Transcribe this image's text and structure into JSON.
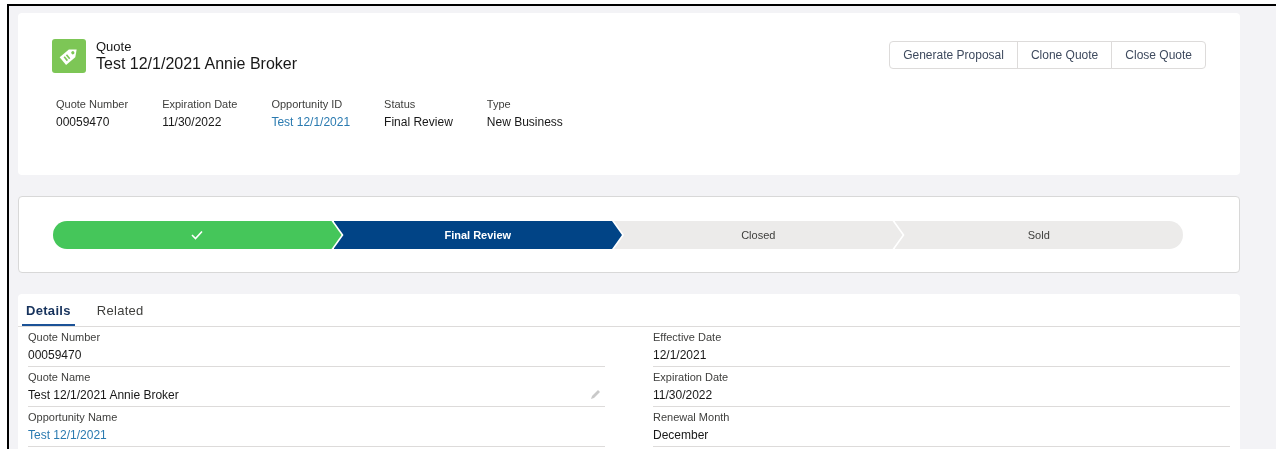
{
  "header": {
    "object_type": "Quote",
    "title": "Test 12/1/2021 Annie Broker",
    "actions": [
      "Generate Proposal",
      "Clone Quote",
      "Close Quote"
    ],
    "highlights": [
      {
        "label": "Quote Number",
        "value": "00059470",
        "link": false
      },
      {
        "label": "Expiration Date",
        "value": "11/30/2022",
        "link": false
      },
      {
        "label": "Opportunity ID",
        "value": "Test 12/1/2021",
        "link": true
      },
      {
        "label": "Status",
        "value": "Final Review",
        "link": false
      },
      {
        "label": "Type",
        "value": "New Business",
        "link": false
      }
    ]
  },
  "path": {
    "stages": [
      {
        "kind": "complete"
      },
      {
        "label": "Final Review",
        "kind": "current"
      },
      {
        "label": "Closed",
        "kind": "incomplete"
      },
      {
        "label": "Sold",
        "kind": "incomplete"
      }
    ]
  },
  "tabs": [
    {
      "label": "Details",
      "selected": true
    },
    {
      "label": "Related",
      "selected": false
    }
  ],
  "fields": {
    "left": [
      {
        "label": "Quote Number",
        "value": "00059470",
        "link": false,
        "editable": false
      },
      {
        "label": "Quote Name",
        "value": "Test 12/1/2021 Annie Broker",
        "link": false,
        "editable": true
      },
      {
        "label": "Opportunity Name",
        "value": "Test 12/1/2021",
        "link": true,
        "editable": false
      }
    ],
    "right": [
      {
        "label": "Effective Date",
        "value": "12/1/2021",
        "link": false,
        "editable": false
      },
      {
        "label": "Expiration Date",
        "value": "11/30/2022",
        "link": false,
        "editable": false
      },
      {
        "label": "Renewal Month",
        "value": "December",
        "link": false,
        "editable": false
      }
    ]
  }
}
